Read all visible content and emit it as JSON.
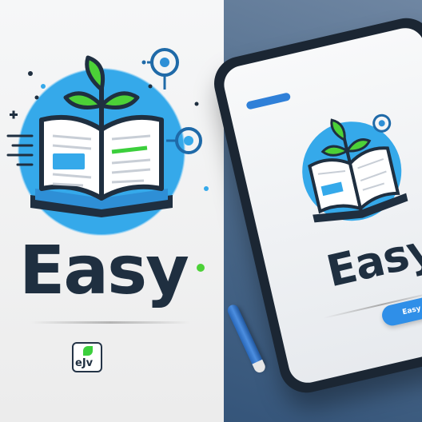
{
  "brand": {
    "wordmark": "Easy",
    "badge_text": "eJv"
  },
  "tablet": {
    "wordmark": "Easy",
    "button_label": "Easy →"
  },
  "colors": {
    "accent_blue": "#2f8fe8",
    "accent_green": "#3ccf3c",
    "ink_dark": "#1f2f40",
    "circle_blue": "#35a9ea"
  },
  "icons": [
    "open-book-icon",
    "sprout-icon",
    "target-icon",
    "sparkle-icon",
    "stylus-icon"
  ]
}
